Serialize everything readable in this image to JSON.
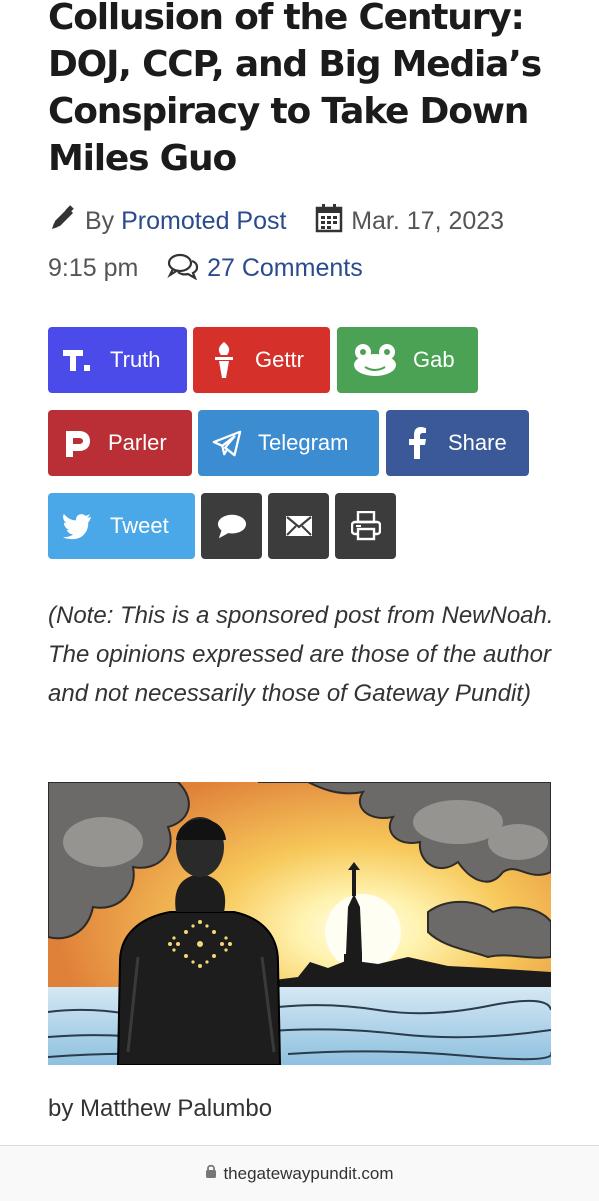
{
  "article": {
    "title": "Collusion of the Century: DOJ, CCP, and Big Media’s Conspiracy to Take Down Miles Guo",
    "by_prefix": "By",
    "author": "Promoted Post",
    "date": "Mar. 17, 2023",
    "time": "9:15 pm",
    "comments": "27 Comments",
    "note": "(Note: This is a sponsored post from NewNoah. The opinions expressed are those of the author and not necessarily those of Gateway Pundit)",
    "byline": "by Matthew Palumbo"
  },
  "share_buttons": [
    {
      "label": "Truth",
      "color": "#4b4bea",
      "icon": "truth-icon"
    },
    {
      "label": "Gettr",
      "color": "#d6302b",
      "icon": "gettr-torch-icon"
    },
    {
      "label": "Gab",
      "color": "#4ba254",
      "icon": "gab-frog-icon"
    },
    {
      "label": "Parler",
      "color": "#ba2e35",
      "icon": "parler-icon"
    },
    {
      "label": "Telegram",
      "color": "#3b8cd1",
      "icon": "telegram-icon"
    },
    {
      "label": "Share",
      "color": "#3b5898",
      "icon": "facebook-icon"
    },
    {
      "label": "Tweet",
      "color": "#4aa7e8",
      "icon": "twitter-bird-icon"
    },
    {
      "label": "",
      "color": "#3c3c3c",
      "icon": "comment-bubble-icon"
    },
    {
      "label": "",
      "color": "#3c3c3c",
      "icon": "email-envelope-icon"
    },
    {
      "label": "",
      "color": "#3c3c3c",
      "icon": "print-icon"
    }
  ],
  "browser": {
    "url": "thegatewaypundit.com"
  }
}
